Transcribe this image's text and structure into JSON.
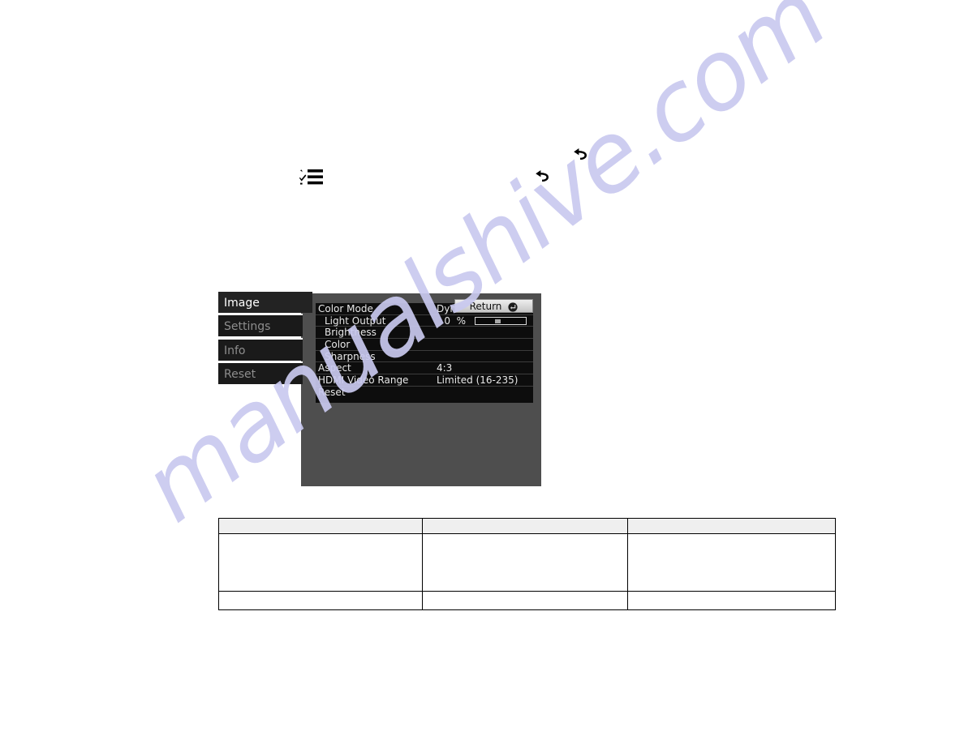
{
  "watermark": {
    "text": "manualshive.com",
    "color": "#c9c9ef"
  },
  "instruction_icons": [
    {
      "name": "menu-checklist-icon",
      "label": "Menu"
    },
    {
      "name": "back-arrow-icon-lower",
      "label": "Return"
    },
    {
      "name": "back-arrow-icon-upper",
      "label": "Return"
    }
  ],
  "osd": {
    "tabs": [
      {
        "label": "Image",
        "state": "selected"
      },
      {
        "label": "Settings",
        "state": "dim"
      },
      {
        "label": "Info",
        "state": "dim"
      },
      {
        "label": "Reset",
        "state": "dim"
      }
    ],
    "return_button": {
      "label": "Return",
      "icon": "enter-circle-icon"
    },
    "rows": [
      {
        "label": "Color Mode",
        "value": "Dynamic",
        "indent": false,
        "type": "value"
      },
      {
        "label": "Light Output",
        "value": "0",
        "unit": "%",
        "indent": true,
        "type": "slider",
        "slider_percent": 0
      },
      {
        "label": "Brightness",
        "value": "",
        "indent": true,
        "type": "submenu"
      },
      {
        "label": "Color",
        "value": "",
        "indent": true,
        "type": "submenu"
      },
      {
        "label": "Sharpness",
        "value": "",
        "indent": true,
        "type": "submenu"
      },
      {
        "label": "Aspect",
        "value": "4:3",
        "indent": false,
        "type": "value"
      },
      {
        "label": "HDMI Video Range",
        "value": "Limited (16-235)",
        "indent": false,
        "type": "value"
      },
      {
        "label": "Reset",
        "value": "",
        "indent": false,
        "type": "submenu"
      }
    ]
  },
  "table": {
    "headers": [
      "",
      "",
      ""
    ],
    "rows": [
      [
        "",
        "",
        ""
      ],
      [
        "",
        "",
        ""
      ]
    ]
  }
}
